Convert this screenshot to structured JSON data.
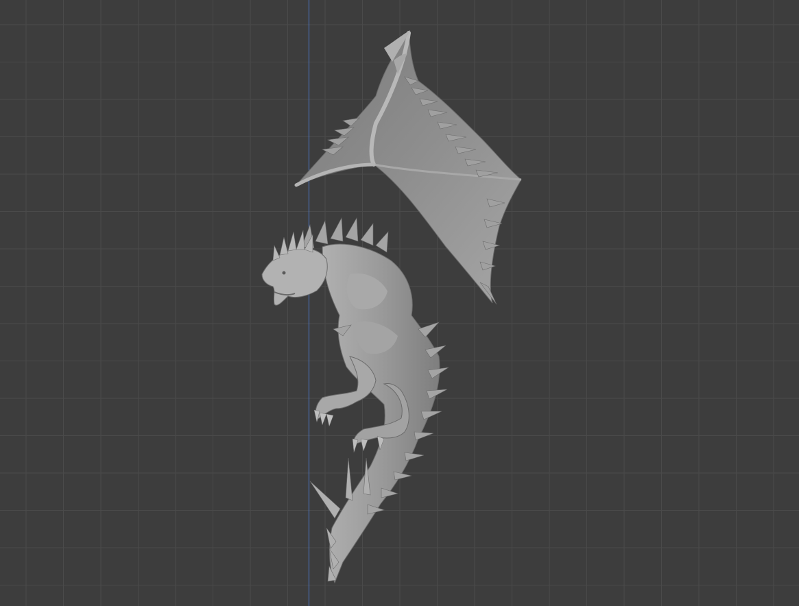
{
  "viewport": {
    "grid_color": "#4a4a4a",
    "background_color": "#3d3d3d",
    "axis_color": "#4e7bd0"
  },
  "model": {
    "icon": "dragon-sculpt",
    "shading": "solid-gray",
    "base_color": "#9a9a9a"
  }
}
